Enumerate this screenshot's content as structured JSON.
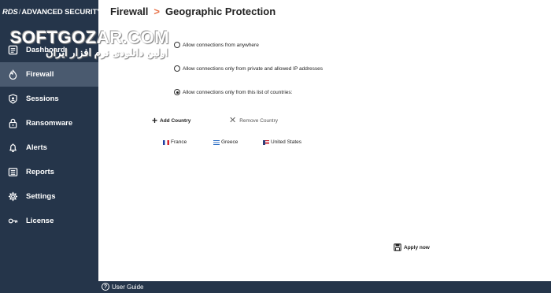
{
  "app": {
    "brand_prefix": "RDS",
    "brand_name": "ADVANCED SECURITY"
  },
  "watermark": {
    "logo_text": "SOFTGOZAR.COM",
    "subtitle": "اولین دانلودی نرم افزار ایران"
  },
  "sidebar": {
    "items": [
      {
        "label": "Dashboard",
        "icon": "dashboard-icon",
        "active": false
      },
      {
        "label": "Firewall",
        "icon": "flame-icon",
        "active": true
      },
      {
        "label": "Sessions",
        "icon": "shield-icon",
        "active": false
      },
      {
        "label": "Ransomware",
        "icon": "lock-icon",
        "active": false
      },
      {
        "label": "Alerts",
        "icon": "bell-icon",
        "active": false
      },
      {
        "label": "Reports",
        "icon": "report-icon",
        "active": false
      },
      {
        "label": "Settings",
        "icon": "gear-icon",
        "active": false
      },
      {
        "label": "License",
        "icon": "key-icon",
        "active": false
      }
    ]
  },
  "header": {
    "section": "Firewall",
    "separator": ">",
    "page": "Geographic Protection"
  },
  "options": [
    {
      "label": "Allow connections from anywhere",
      "checked": false
    },
    {
      "label": "Allow connections only from private and allowed IP addresses",
      "checked": false
    },
    {
      "label": "Allow connections only from this list of countries:",
      "checked": true
    }
  ],
  "actions": {
    "add_label": "Add Country",
    "remove_label": "Remove Country"
  },
  "countries": [
    {
      "name": "France",
      "flag": "france-flag"
    },
    {
      "name": "Greece",
      "flag": "greece-flag"
    },
    {
      "name": "United States",
      "flag": "us-flag"
    }
  ],
  "apply_label": "Apply now",
  "footer": {
    "guide_label": "User Guide"
  },
  "colors": {
    "sidebar_bg": "#25354a",
    "active_bg": "#4a5a6f",
    "accent": "#e8734a"
  }
}
